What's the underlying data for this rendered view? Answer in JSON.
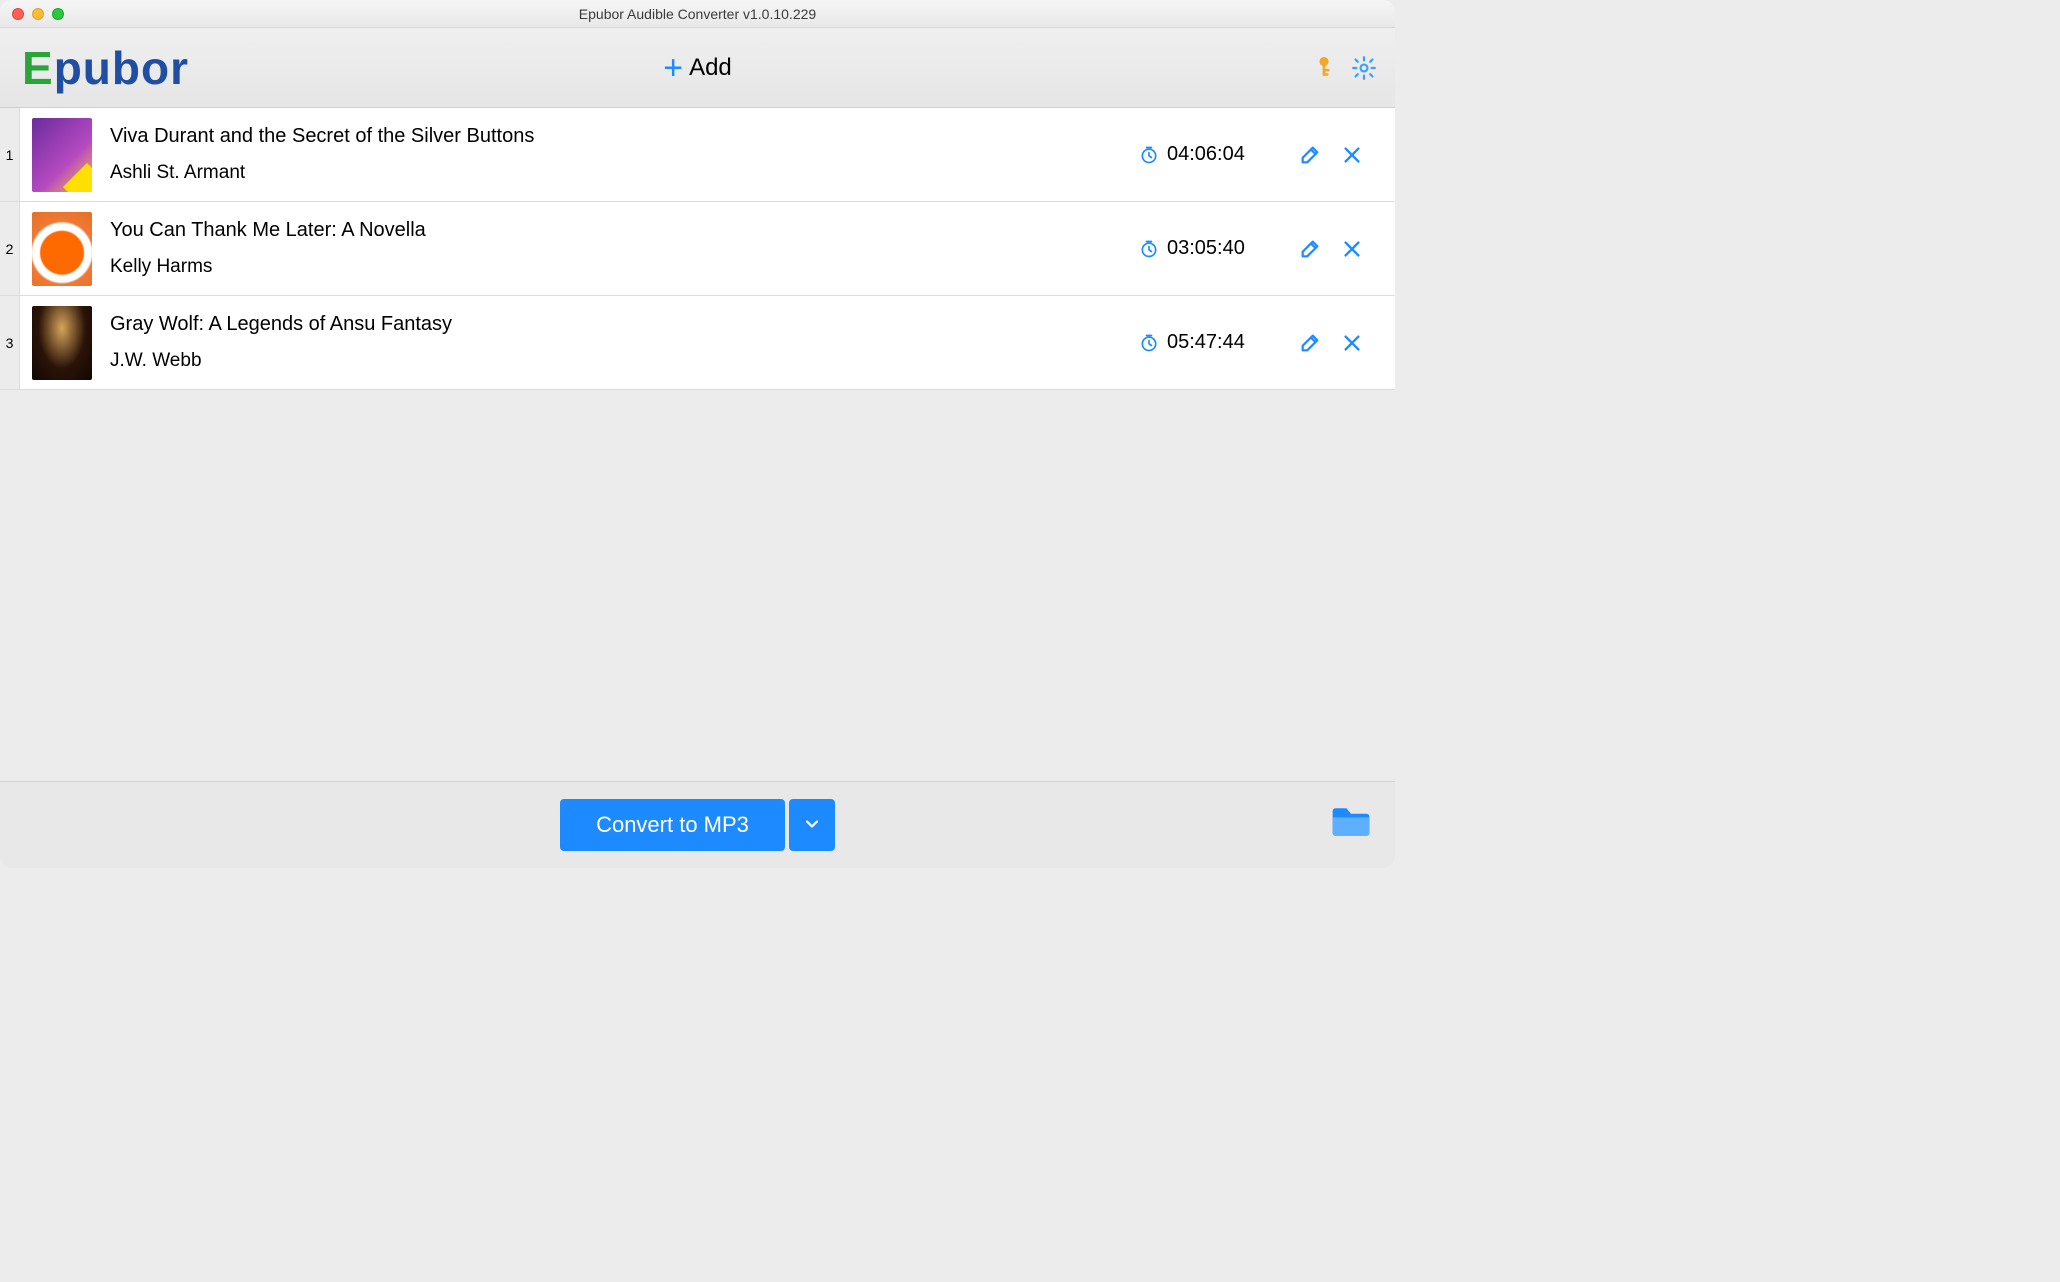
{
  "window": {
    "title": "Epubor Audible Converter v1.0.10.229"
  },
  "logo": {
    "first_letter": "E",
    "rest": "pubor"
  },
  "toolbar": {
    "add_label": "Add",
    "key_icon": "key-icon",
    "settings_icon": "gear-icon"
  },
  "list": {
    "items": [
      {
        "index": "1",
        "title": "Viva Durant and the Secret of the Silver Buttons",
        "author": "Ashli St. Armant",
        "duration": "04:06:04"
      },
      {
        "index": "2",
        "title": "You Can Thank Me Later: A Novella",
        "author": "Kelly Harms",
        "duration": "03:05:40"
      },
      {
        "index": "3",
        "title": "Gray Wolf: A Legends of Ansu Fantasy",
        "author": "J.W. Webb",
        "duration": "05:47:44"
      }
    ]
  },
  "bottom": {
    "convert_label": "Convert to MP3"
  },
  "colors": {
    "accent": "#1d8aff",
    "key": "#f5a623",
    "gear": "#3aa0ff"
  }
}
